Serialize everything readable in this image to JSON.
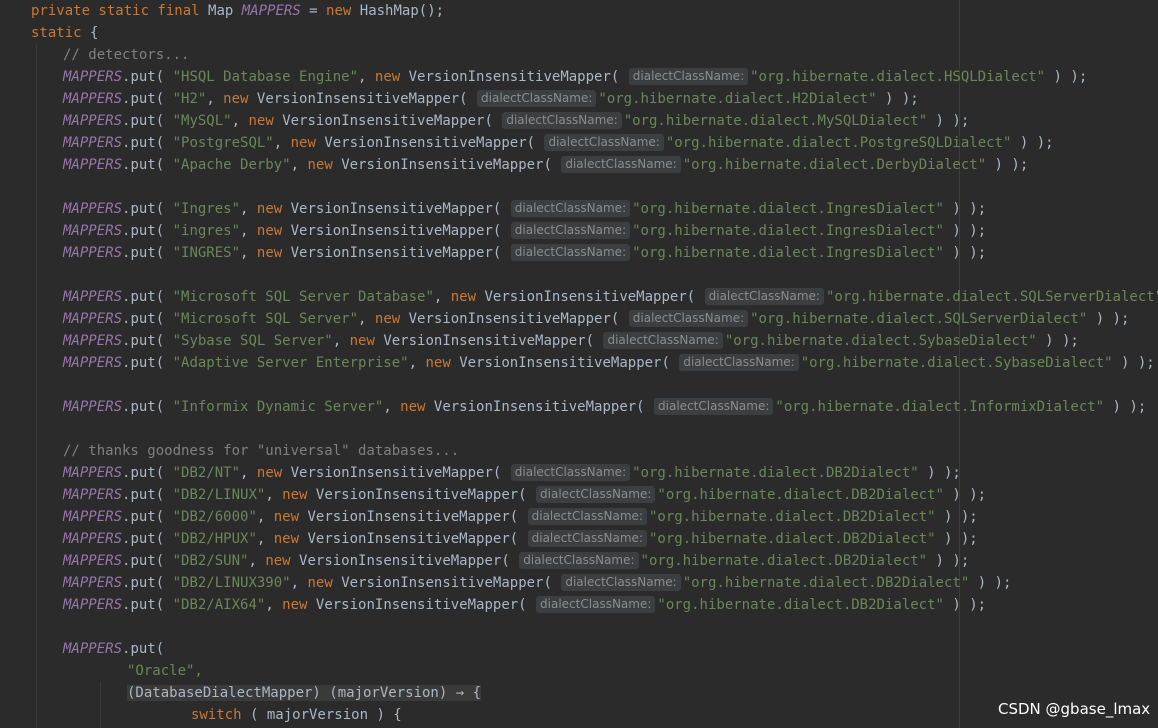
{
  "code": {
    "line_01": {
      "kw1": "private static final ",
      "type": "Map ",
      "field": "MAPPERS",
      "eq": " = ",
      "kw2": "new ",
      "rest": "HashMap();",
      "semi": ""
    },
    "line_02": {
      "kw": "static ",
      "brace": "{"
    },
    "line_03": {
      "comment": "// detectors..."
    },
    "hint_label": "dialectClassName:",
    "mapper_class": "VersionInsensitiveMapper(",
    "put_call": ".put( ",
    "field_name": "MAPPERS",
    "kw_new": "new ",
    "entries": [
      {
        "db": "\"HSQL Database Engine\"",
        "dialect": "\"org.hibernate.dialect.HSQLDialect\""
      },
      {
        "db": "\"H2\"",
        "dialect": "\"org.hibernate.dialect.H2Dialect\""
      },
      {
        "db": "\"MySQL\"",
        "dialect": "\"org.hibernate.dialect.MySQLDialect\""
      },
      {
        "db": "\"PostgreSQL\"",
        "dialect": "\"org.hibernate.dialect.PostgreSQLDialect\""
      },
      {
        "db": "\"Apache Derby\"",
        "dialect": "\"org.hibernate.dialect.DerbyDialect\""
      },
      {
        "db": "\"Ingres\"",
        "dialect": "\"org.hibernate.dialect.IngresDialect\""
      },
      {
        "db": "\"ingres\"",
        "dialect": "\"org.hibernate.dialect.IngresDialect\""
      },
      {
        "db": "\"INGRES\"",
        "dialect": "\"org.hibernate.dialect.IngresDialect\""
      },
      {
        "db": "\"Microsoft SQL Server Database\"",
        "dialect": "\"org.hibernate.dialect.SQLServerDialect\""
      },
      {
        "db": "\"Microsoft SQL Server\"",
        "dialect": "\"org.hibernate.dialect.SQLServerDialect\""
      },
      {
        "db": "\"Sybase SQL Server\"",
        "dialect": "\"org.hibernate.dialect.SybaseDialect\""
      },
      {
        "db": "\"Adaptive Server Enterprise\"",
        "dialect": "\"org.hibernate.dialect.SybaseDialect\""
      },
      {
        "db": "\"Informix Dynamic Server\"",
        "dialect": "\"org.hibernate.dialect.InformixDialect\""
      },
      {
        "db": "\"DB2/NT\"",
        "dialect": "\"org.hibernate.dialect.DB2Dialect\""
      },
      {
        "db": "\"DB2/LINUX\"",
        "dialect": "\"org.hibernate.dialect.DB2Dialect\""
      },
      {
        "db": "\"DB2/6000\"",
        "dialect": "\"org.hibernate.dialect.DB2Dialect\""
      },
      {
        "db": "\"DB2/HPUX\"",
        "dialect": "\"org.hibernate.dialect.DB2Dialect\""
      },
      {
        "db": "\"DB2/SUN\"",
        "dialect": "\"org.hibernate.dialect.DB2Dialect\""
      },
      {
        "db": "\"DB2/LINUX390\"",
        "dialect": "\"org.hibernate.dialect.DB2Dialect\""
      },
      {
        "db": "\"DB2/AIX64\"",
        "dialect": "\"org.hibernate.dialect.DB2Dialect\""
      }
    ],
    "close_paren": " ) );",
    "comment_universal": "// thanks goodness for \"universal\" databases...",
    "mappers_put_open": ".put(",
    "oracle_str": "\"Oracle\",",
    "lambda_text": "(DatabaseDialectMapper) (majorVersion) → {",
    "switch_kw": "switch",
    "switch_rest": " ( majorVersion ) {"
  },
  "watermark": "CSDN @gbase_lmax",
  "colors": {
    "background": "#2b2b2b",
    "keyword": "#cc7832",
    "field": "#9876aa",
    "string": "#6a8759",
    "comment": "#808080",
    "text": "#a9b7c6",
    "hint_bg": "#3b3f41"
  }
}
